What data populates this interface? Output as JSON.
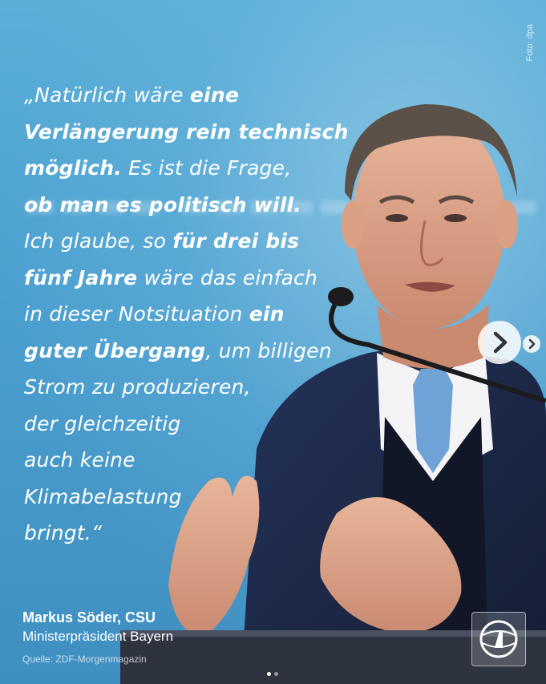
{
  "quote": {
    "lines": [
      [
        {
          "t": "„Natürlich wäre ",
          "b": false
        },
        {
          "t": "eine",
          "b": true
        }
      ],
      [
        {
          "t": "Verlängerung rein technisch",
          "b": true
        }
      ],
      [
        {
          "t": "möglich.",
          "b": true
        },
        {
          "t": " Es ist die Frage,",
          "b": false
        }
      ],
      [
        {
          "t": "ob man es politisch will.",
          "b": true
        }
      ],
      [
        {
          "t": "Ich glaube, so ",
          "b": false
        },
        {
          "t": "für drei bis",
          "b": true
        }
      ],
      [
        {
          "t": "fünf Jahre",
          "b": true
        },
        {
          "t": " wäre das einfach",
          "b": false
        }
      ],
      [
        {
          "t": "in dieser Notsituation ",
          "b": false
        },
        {
          "t": "ein",
          "b": true
        }
      ],
      [
        {
          "t": "guter Übergang",
          "b": true
        },
        {
          "t": ", um billigen",
          "b": false
        }
      ],
      [
        {
          "t": "Strom zu produzieren,",
          "b": false
        }
      ],
      [
        {
          "t": "der gleichzeitig",
          "b": false
        }
      ],
      [
        {
          "t": "auch keine",
          "b": false
        }
      ],
      [
        {
          "t": "Klimabelastung",
          "b": false
        }
      ],
      [
        {
          "t": "bringt.“",
          "b": false
        }
      ]
    ]
  },
  "speaker": {
    "name": "Markus Söder, CSU",
    "role": "Ministerpräsident Bayern"
  },
  "source": "Quelle: ZDF-Morgenmagazin",
  "photo_credit": "Foto: dpa",
  "carousel": {
    "current": 1,
    "total": 2
  },
  "icons": {
    "next": "chevron-right-icon",
    "logo": "ard-tagesschau-logo"
  },
  "colors": {
    "background": "#4fa3cf",
    "suit": "#1d2a45",
    "tie": "#6fa3d8",
    "text": "#ffffff"
  }
}
